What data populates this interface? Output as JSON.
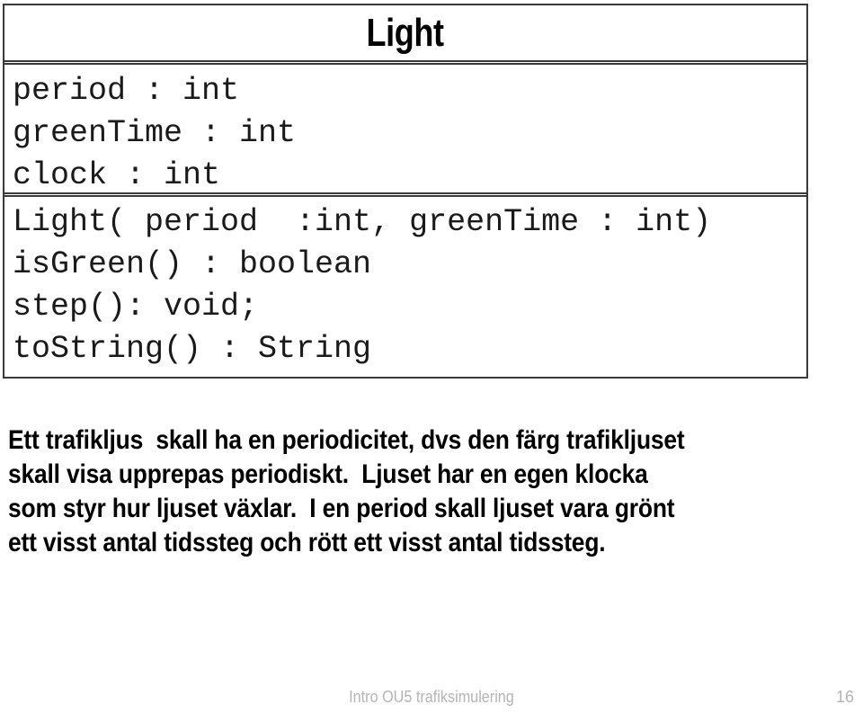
{
  "slide": {
    "uml": {
      "class_name": "Light",
      "attributes": [
        "period : int",
        "greenTime : int",
        "clock : int"
      ],
      "operations": [
        "Light( period  :int, greenTime : int)",
        "isGreen() : boolean",
        "step(): void;",
        "toString() : String"
      ]
    },
    "body_lines": [
      "Ett trafikljus  skall ha en periodicitet, dvs den färg trafikljuset",
      "skall visa upprepas periodiskt.  Ljuset har en egen klocka",
      "som styr hur ljuset växlar.  I en period skall ljuset vara grönt",
      "ett visst antal tidssteg och rött ett visst antal tidssteg."
    ],
    "footer": {
      "text": "Intro OU5 trafiksimulering",
      "page_number": "16"
    },
    "colors": {
      "border": "#3a3a3a",
      "text": "#000000",
      "footer_text": "#b4b4b4",
      "background": "#ffffff"
    }
  }
}
